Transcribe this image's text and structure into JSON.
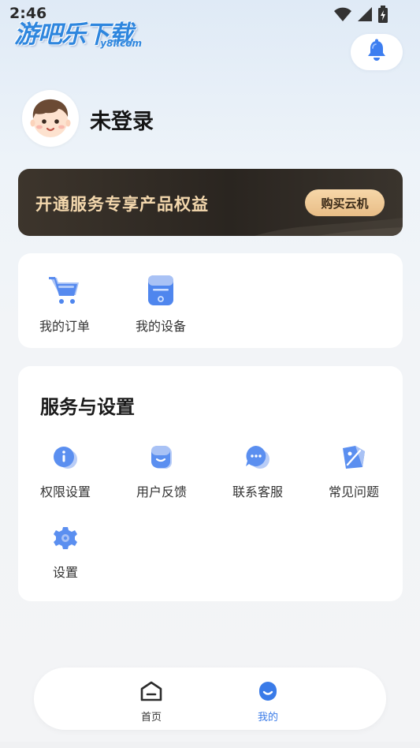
{
  "status_bar": {
    "time": "2:46",
    "icons": [
      "wifi-icon",
      "signal-icon",
      "battery-icon"
    ]
  },
  "watermark": {
    "text": "游吧乐下载",
    "sub": "y8l.com"
  },
  "header": {
    "bell_icon": "bell-icon"
  },
  "profile": {
    "avatar_icon": "boy-avatar",
    "name": "未登录"
  },
  "vip_banner": {
    "text": "开通服务专享产品权益",
    "button_label": "购买云机"
  },
  "quick_actions": [
    {
      "label": "我的订单",
      "icon": "cart-icon"
    },
    {
      "label": "我的设备",
      "icon": "device-icon"
    }
  ],
  "services": {
    "title": "服务与设置",
    "items": [
      {
        "label": "权限设置",
        "icon": "info-icon"
      },
      {
        "label": "用户反馈",
        "icon": "feedback-icon"
      },
      {
        "label": "联系客服",
        "icon": "chat-icon"
      },
      {
        "label": "常见问题",
        "icon": "faq-icon"
      },
      {
        "label": "设置",
        "icon": "gear-icon"
      }
    ]
  },
  "tab_bar": {
    "tabs": [
      {
        "label": "首页",
        "icon": "home-icon",
        "active": false
      },
      {
        "label": "我的",
        "icon": "profile-icon",
        "active": true
      }
    ]
  },
  "colors": {
    "accent": "#3a7be8",
    "icon_blue": "#5b8ff0",
    "icon_light": "#a9c2f5",
    "vip_gold": "#f4d8ad",
    "vip_dark": "#2a2520"
  }
}
